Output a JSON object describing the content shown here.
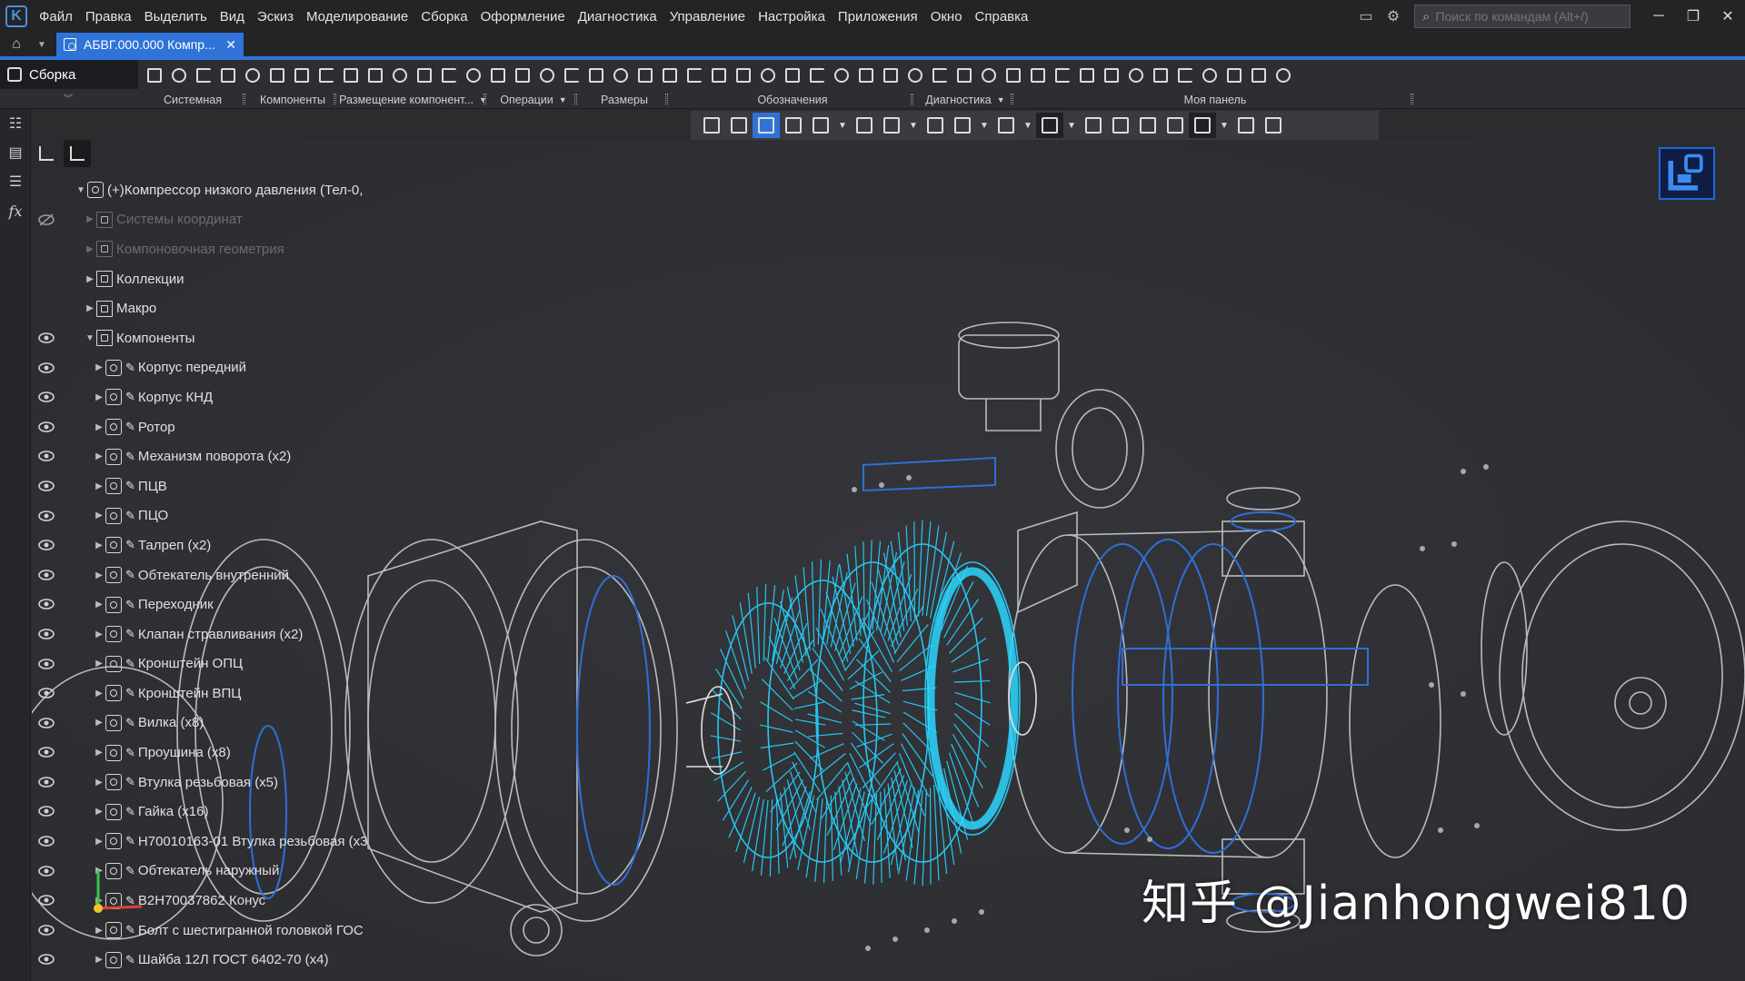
{
  "menu": [
    "Файл",
    "Правка",
    "Выделить",
    "Вид",
    "Эскиз",
    "Моделирование",
    "Сборка",
    "Оформление",
    "Диагностика",
    "Управление",
    "Настройка",
    "Приложения",
    "Окно",
    "Справка"
  ],
  "search": {
    "placeholder": "Поиск по командам (Alt+/)"
  },
  "tab": {
    "label": "АБВГ.000.000 Компр..."
  },
  "mode": {
    "label": "Сборка"
  },
  "ribbon_groups": [
    {
      "label": "Системная",
      "dropdown": false
    },
    {
      "label": "Компоненты",
      "dropdown": false
    },
    {
      "label": "Размещение компонент...",
      "dropdown": true
    },
    {
      "label": "Операции",
      "dropdown": true
    },
    {
      "label": "Размеры",
      "dropdown": false
    },
    {
      "label": "Обозначения",
      "dropdown": false
    },
    {
      "label": "Диагностика",
      "dropdown": true
    },
    {
      "label": "Моя панель",
      "dropdown": false
    }
  ],
  "tree": [
    {
      "label": "(+)Компрессор низкого давления (Тел-0,",
      "arrow": "▼",
      "eye": false,
      "dim": false,
      "pin": false
    },
    {
      "label": "Системы координат",
      "arrow": "▶",
      "eye": true,
      "dim": true,
      "pin": false
    },
    {
      "label": "Компоновочная геометрия",
      "arrow": "▶",
      "eye": false,
      "dim": true,
      "pin": false
    },
    {
      "label": "Коллекции",
      "arrow": "▶",
      "eye": false,
      "dim": false,
      "pin": false
    },
    {
      "label": "Макро",
      "arrow": "▶",
      "eye": false,
      "dim": false,
      "pin": false
    },
    {
      "label": "Компоненты",
      "arrow": "▼",
      "eye": true,
      "dim": false,
      "pin": false
    },
    {
      "label": "Корпус передний",
      "arrow": "▶",
      "eye": true,
      "dim": false,
      "pin": true
    },
    {
      "label": "Корпус КНД",
      "arrow": "▶",
      "eye": true,
      "dim": false,
      "pin": true
    },
    {
      "label": "Ротор",
      "arrow": "▶",
      "eye": true,
      "dim": false,
      "pin": true
    },
    {
      "label": "Механизм поворота (x2)",
      "arrow": "▶",
      "eye": true,
      "dim": false,
      "pin": true
    },
    {
      "label": "ПЦВ",
      "arrow": "▶",
      "eye": true,
      "dim": false,
      "pin": true
    },
    {
      "label": "ПЦО",
      "arrow": "▶",
      "eye": true,
      "dim": false,
      "pin": true
    },
    {
      "label": "Талреп (x2)",
      "arrow": "▶",
      "eye": true,
      "dim": false,
      "pin": true
    },
    {
      "label": "Обтекатель внутренний",
      "arrow": "▶",
      "eye": true,
      "dim": false,
      "pin": true
    },
    {
      "label": "Переходник",
      "arrow": "▶",
      "eye": true,
      "dim": false,
      "pin": true
    },
    {
      "label": "Клапан стравливания (x2)",
      "arrow": "▶",
      "eye": true,
      "dim": false,
      "pin": true
    },
    {
      "label": "Кронштейн ОПЦ",
      "arrow": "▶",
      "eye": true,
      "dim": false,
      "pin": true
    },
    {
      "label": "Кронштейн ВПЦ",
      "arrow": "▶",
      "eye": true,
      "dim": false,
      "pin": true
    },
    {
      "label": "Вилка (x8)",
      "arrow": "▶",
      "eye": true,
      "dim": false,
      "pin": true
    },
    {
      "label": "Проушина (x8)",
      "arrow": "▶",
      "eye": true,
      "dim": false,
      "pin": true
    },
    {
      "label": "Втулка резьбовая (x5)",
      "arrow": "▶",
      "eye": true,
      "dim": false,
      "pin": true
    },
    {
      "label": "Гайка (x16)",
      "arrow": "▶",
      "eye": true,
      "dim": false,
      "pin": true
    },
    {
      "label": "Н70010163-01 Втулка резьбовая (x3",
      "arrow": "▶",
      "eye": true,
      "dim": false,
      "pin": true
    },
    {
      "label": "Обтекатель наружный",
      "arrow": "▶",
      "eye": true,
      "dim": false,
      "pin": true
    },
    {
      "label": "В2Н70037862 Конус",
      "arrow": "▶",
      "eye": true,
      "dim": false,
      "pin": true
    },
    {
      "label": "Болт с шестигранной головкой ГОС",
      "arrow": "▶",
      "eye": true,
      "dim": false,
      "pin": true
    },
    {
      "label": "Шайба 12Л ГОСТ 6402-70 (x4)",
      "arrow": "▶",
      "eye": true,
      "dim": false,
      "pin": true
    }
  ],
  "watermark": "知乎 @Jianhongwei810",
  "colors": {
    "accent": "#2f73d8",
    "blades": "#26c6f0",
    "wire": "#b9bbbf",
    "wire_blue": "#2e6fd6",
    "background": "#2b2c2e"
  }
}
